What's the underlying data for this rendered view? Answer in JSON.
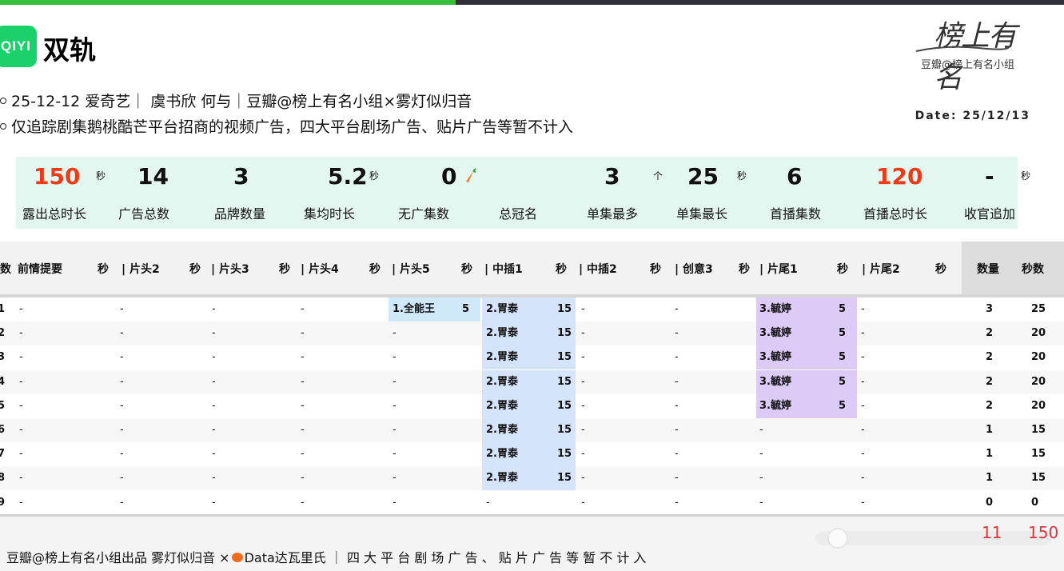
{
  "header": {
    "logo_text": "QIYI",
    "title": "双轨",
    "info_line1": "25-12-12 爱奇艺｜ 虞书欣 何与｜豆瓣@榜上有名小组×雾灯似归音",
    "info_line2": "仅追踪剧集鹅桃酷芒平台招商的视频广告，四大平台剧场广告、贴片广告等暂不计入",
    "date": "Date: 25/12/13",
    "brand_calligraphy": "榜上有名",
    "brand_caption": "豆瓣@榜上有名小组"
  },
  "stats": [
    {
      "value": "150",
      "unit": "秒",
      "label": "露出总时长",
      "color": "red"
    },
    {
      "value": "14",
      "unit": "",
      "label": "广告总数",
      "color": "black"
    },
    {
      "value": "3",
      "unit": "",
      "label": "品牌数量",
      "color": "black"
    },
    {
      "value": "5.2",
      "unit": "秒",
      "label": "集均时长",
      "color": "black"
    },
    {
      "value": "0",
      "unit": "",
      "label": "无广集数",
      "color": "black"
    },
    {
      "value": "",
      "unit": "",
      "label": "总冠名",
      "color": "black"
    },
    {
      "value": "3",
      "unit": "个",
      "label": "单集最多",
      "color": "black"
    },
    {
      "value": "25",
      "unit": "秒",
      "label": "单集最长",
      "color": "black"
    },
    {
      "value": "6",
      "unit": "",
      "label": "首播集数",
      "color": "black"
    },
    {
      "value": "120",
      "unit": "",
      "label": "首播总时长",
      "color": "red"
    },
    {
      "value": "-",
      "unit": "秒",
      "label": "收官追加",
      "color": "black"
    }
  ],
  "table": {
    "headers": [
      {
        "name": "数",
        "unit": ""
      },
      {
        "name": "前情提要",
        "unit": "秒"
      },
      {
        "name": "| 片头2",
        "unit": "秒"
      },
      {
        "name": "| 片头3",
        "unit": "秒"
      },
      {
        "name": "| 片头4",
        "unit": "秒"
      },
      {
        "name": "| 片头5",
        "unit": "秒"
      },
      {
        "name": "| 中插1",
        "unit": "秒"
      },
      {
        "name": "| 中插2",
        "unit": "秒"
      },
      {
        "name": "| 创意3",
        "unit": "秒"
      },
      {
        "name": "| 片尾1",
        "unit": "秒"
      },
      {
        "name": "| 片尾2",
        "unit": "秒"
      },
      {
        "name": "数量",
        "unit": ""
      },
      {
        "name": "秒数",
        "unit": ""
      }
    ],
    "rows": [
      {
        "ep": "1",
        "cells": [
          [
            "-",
            ""
          ],
          [
            "-",
            ""
          ],
          [
            "-",
            ""
          ],
          [
            "-",
            ""
          ],
          [
            "1.全能王",
            "5"
          ],
          [
            "2.胃泰",
            "15"
          ],
          [
            "-",
            ""
          ],
          [
            "-",
            ""
          ],
          [
            "3.毓婷",
            "5"
          ],
          [
            "-",
            ""
          ]
        ],
        "count": "3",
        "secs": "25"
      },
      {
        "ep": "2",
        "cells": [
          [
            "-",
            ""
          ],
          [
            "-",
            ""
          ],
          [
            "-",
            ""
          ],
          [
            "-",
            ""
          ],
          [
            "-",
            ""
          ],
          [
            "2.胃泰",
            "15"
          ],
          [
            "-",
            ""
          ],
          [
            "-",
            ""
          ],
          [
            "3.毓婷",
            "5"
          ],
          [
            "-",
            ""
          ]
        ],
        "count": "2",
        "secs": "20"
      },
      {
        "ep": "3",
        "cells": [
          [
            "-",
            ""
          ],
          [
            "-",
            ""
          ],
          [
            "-",
            ""
          ],
          [
            "-",
            ""
          ],
          [
            "-",
            ""
          ],
          [
            "2.胃泰",
            "15"
          ],
          [
            "-",
            ""
          ],
          [
            "-",
            ""
          ],
          [
            "3.毓婷",
            "5"
          ],
          [
            "-",
            ""
          ]
        ],
        "count": "2",
        "secs": "20"
      },
      {
        "ep": "4",
        "cells": [
          [
            "-",
            ""
          ],
          [
            "-",
            ""
          ],
          [
            "-",
            ""
          ],
          [
            "-",
            ""
          ],
          [
            "-",
            ""
          ],
          [
            "2.胃泰",
            "15"
          ],
          [
            "-",
            ""
          ],
          [
            "-",
            ""
          ],
          [
            "3.毓婷",
            "5"
          ],
          [
            "-",
            ""
          ]
        ],
        "count": "2",
        "secs": "20"
      },
      {
        "ep": "5",
        "cells": [
          [
            "-",
            ""
          ],
          [
            "-",
            ""
          ],
          [
            "-",
            ""
          ],
          [
            "-",
            ""
          ],
          [
            "-",
            ""
          ],
          [
            "2.胃泰",
            "15"
          ],
          [
            "-",
            ""
          ],
          [
            "-",
            ""
          ],
          [
            "3.毓婷",
            "5"
          ],
          [
            "-",
            ""
          ]
        ],
        "count": "2",
        "secs": "20"
      },
      {
        "ep": "6",
        "cells": [
          [
            "-",
            ""
          ],
          [
            "-",
            ""
          ],
          [
            "-",
            ""
          ],
          [
            "-",
            ""
          ],
          [
            "-",
            ""
          ],
          [
            "2.胃泰",
            "15"
          ],
          [
            "-",
            ""
          ],
          [
            "-",
            ""
          ],
          [
            "-",
            ""
          ],
          [
            "-",
            ""
          ]
        ],
        "count": "1",
        "secs": "15"
      },
      {
        "ep": "7",
        "cells": [
          [
            "-",
            ""
          ],
          [
            "-",
            ""
          ],
          [
            "-",
            ""
          ],
          [
            "-",
            ""
          ],
          [
            "-",
            ""
          ],
          [
            "2.胃泰",
            "15"
          ],
          [
            "-",
            ""
          ],
          [
            "-",
            ""
          ],
          [
            "-",
            ""
          ],
          [
            "-",
            ""
          ]
        ],
        "count": "1",
        "secs": "15"
      },
      {
        "ep": "8",
        "cells": [
          [
            "-",
            ""
          ],
          [
            "-",
            ""
          ],
          [
            "-",
            ""
          ],
          [
            "-",
            ""
          ],
          [
            "-",
            ""
          ],
          [
            "2.胃泰",
            "15"
          ],
          [
            "-",
            ""
          ],
          [
            "-",
            ""
          ],
          [
            "-",
            ""
          ],
          [
            "-",
            ""
          ]
        ],
        "count": "1",
        "secs": "15"
      },
      {
        "ep": "9",
        "cells": [
          [
            "-",
            ""
          ],
          [
            "-",
            ""
          ],
          [
            "-",
            ""
          ],
          [
            "-",
            ""
          ],
          [
            "-",
            ""
          ],
          [
            "-",
            ""
          ],
          [
            "-",
            ""
          ],
          [
            "-",
            ""
          ],
          [
            "-",
            ""
          ],
          [
            "-",
            ""
          ]
        ],
        "count": "0",
        "secs": "0"
      }
    ]
  },
  "footer": {
    "text_a": "豆瓣@榜上有名小组出品  雾灯似归音 ×",
    "text_b": "Data达瓦里氏 ｜ 四 大 平 台 剧 场 广 告 、 贴 片 广 告 等 暂 不 计 入",
    "total_count": "11",
    "total_secs": "150"
  },
  "colors": {
    "accent_green": "#1bd16b",
    "stat_red": "#ef3a1a",
    "highlight_blue": "#cfe9fb",
    "highlight_purple": "#dccbf6"
  }
}
